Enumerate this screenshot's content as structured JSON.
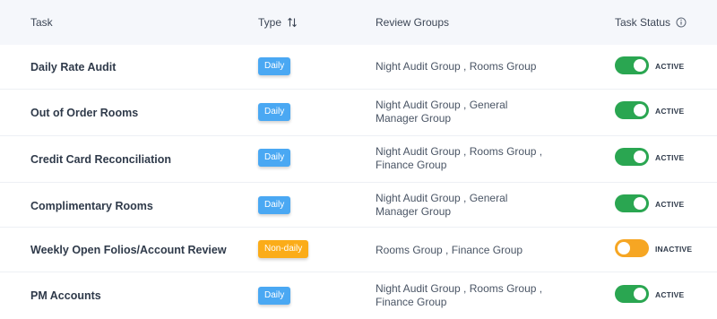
{
  "header": {
    "task": "Task",
    "type": "Type",
    "review_groups": "Review Groups",
    "task_status": "Task Status"
  },
  "rows": [
    {
      "task": "Daily Rate Audit",
      "type": "Daily",
      "groups_line1": "Night Audit Group , Rooms Group",
      "groups_line2": "",
      "status": "ACTIVE"
    },
    {
      "task": "Out of Order Rooms",
      "type": "Daily",
      "groups_line1": "Night Audit Group , General",
      "groups_line2": "Manager Group",
      "status": "ACTIVE"
    },
    {
      "task": "Credit Card Reconciliation",
      "type": "Daily",
      "groups_line1": "Night Audit Group , Rooms Group ,",
      "groups_line2": "Finance Group",
      "status": "ACTIVE"
    },
    {
      "task": "Complimentary Rooms",
      "type": "Daily",
      "groups_line1": "Night Audit Group , General",
      "groups_line2": "Manager Group",
      "status": "ACTIVE"
    },
    {
      "task": "Weekly Open Folios/Account Review",
      "type": "Non-daily",
      "groups_line1": "Rooms Group , Finance Group",
      "groups_line2": "",
      "status": "INACTIVE"
    },
    {
      "task": "PM Accounts",
      "type": "Daily",
      "groups_line1": "Night Audit Group , Rooms Group ,",
      "groups_line2": "Finance Group",
      "status": "ACTIVE"
    }
  ],
  "icons": {
    "sort": "sort-arrows-icon",
    "info": "info-icon"
  },
  "colors": {
    "active_toggle": "#2aa651",
    "inactive_toggle": "#f6a623",
    "daily_badge": "#4aa8f3",
    "nondaily_badge": "#fbac19"
  }
}
